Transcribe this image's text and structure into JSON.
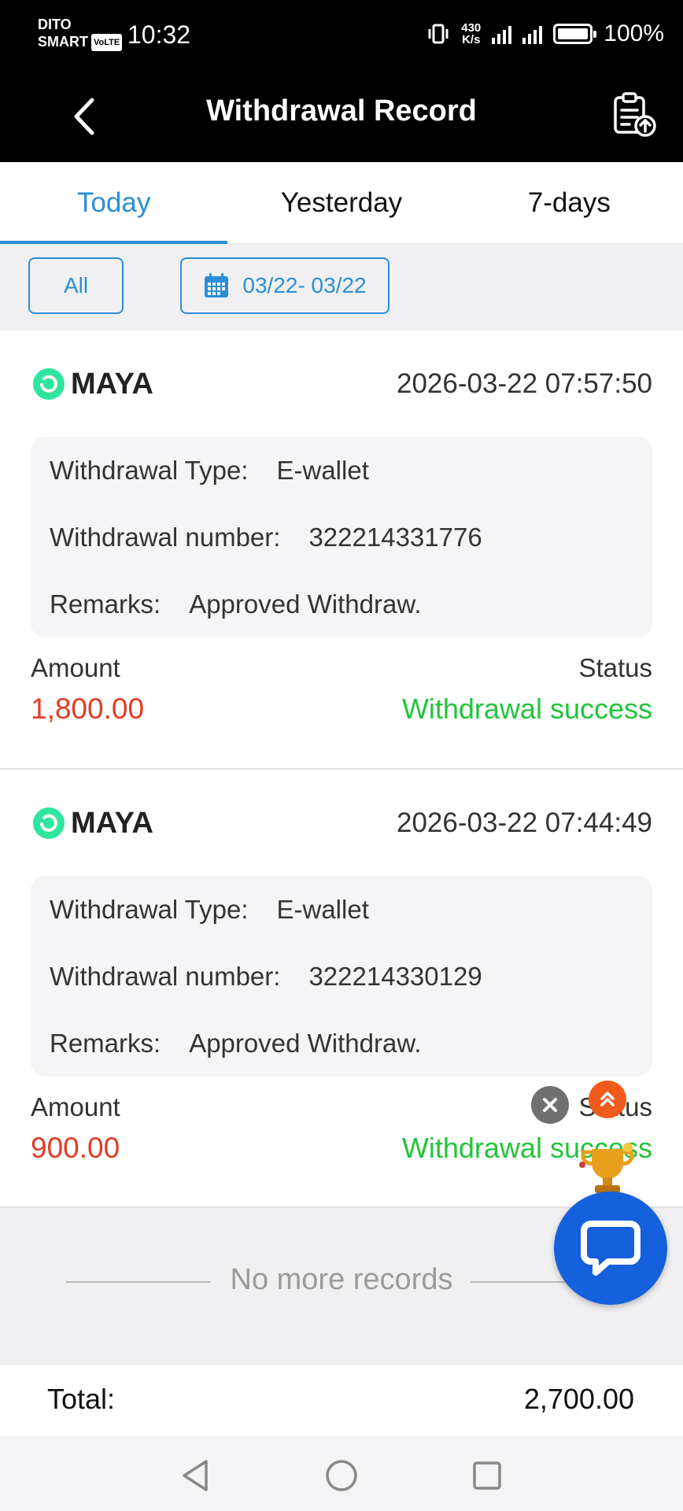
{
  "status_bar": {
    "carrier_line1": "DITO",
    "carrier_line2": "SMART",
    "volte": "VoLTE",
    "time": "10:32",
    "net_speed_value": "430",
    "net_speed_unit": "K/s",
    "battery": "100%"
  },
  "header": {
    "title": "Withdrawal Record",
    "back_icon": "chevron-left-icon",
    "action_icon": "clipboard-upload-icon"
  },
  "tabs": [
    {
      "label": "Today",
      "active": true
    },
    {
      "label": "Yesterday",
      "active": false
    },
    {
      "label": "7-days",
      "active": false
    }
  ],
  "filters": {
    "all_label": "All",
    "date_range": "03/22- 03/22",
    "date_icon": "calendar-icon"
  },
  "records": [
    {
      "brand": "MAYA",
      "datetime": "2026-03-22 07:57:50",
      "type_label": "Withdrawal Type:",
      "type_value": "E-wallet",
      "number_label": "Withdrawal number:",
      "number_value": "322214331776",
      "remarks_label": "Remarks:",
      "remarks_value": "Approved Withdraw.",
      "amount_label": "Amount",
      "amount_value": "1,800.00",
      "status_label": "Status",
      "status_value": "Withdrawal success"
    },
    {
      "brand": "MAYA",
      "datetime": "2026-03-22 07:44:49",
      "type_label": "Withdrawal Type:",
      "type_value": "E-wallet",
      "number_label": "Withdrawal number:",
      "number_value": "322214330129",
      "remarks_label": "Remarks:",
      "remarks_value": "Approved Withdraw.",
      "amount_label": "Amount",
      "amount_value": "900.00",
      "status_label": "Status",
      "status_value": "Withdrawal success"
    }
  ],
  "no_more": "No more records",
  "total": {
    "label": "Total:",
    "value": "2,700.00"
  },
  "colors": {
    "accent": "#2a8ed6",
    "amount": "#e23b26",
    "success": "#22c43a",
    "chat": "#1560dc",
    "maya_green": "#2ee59d"
  }
}
